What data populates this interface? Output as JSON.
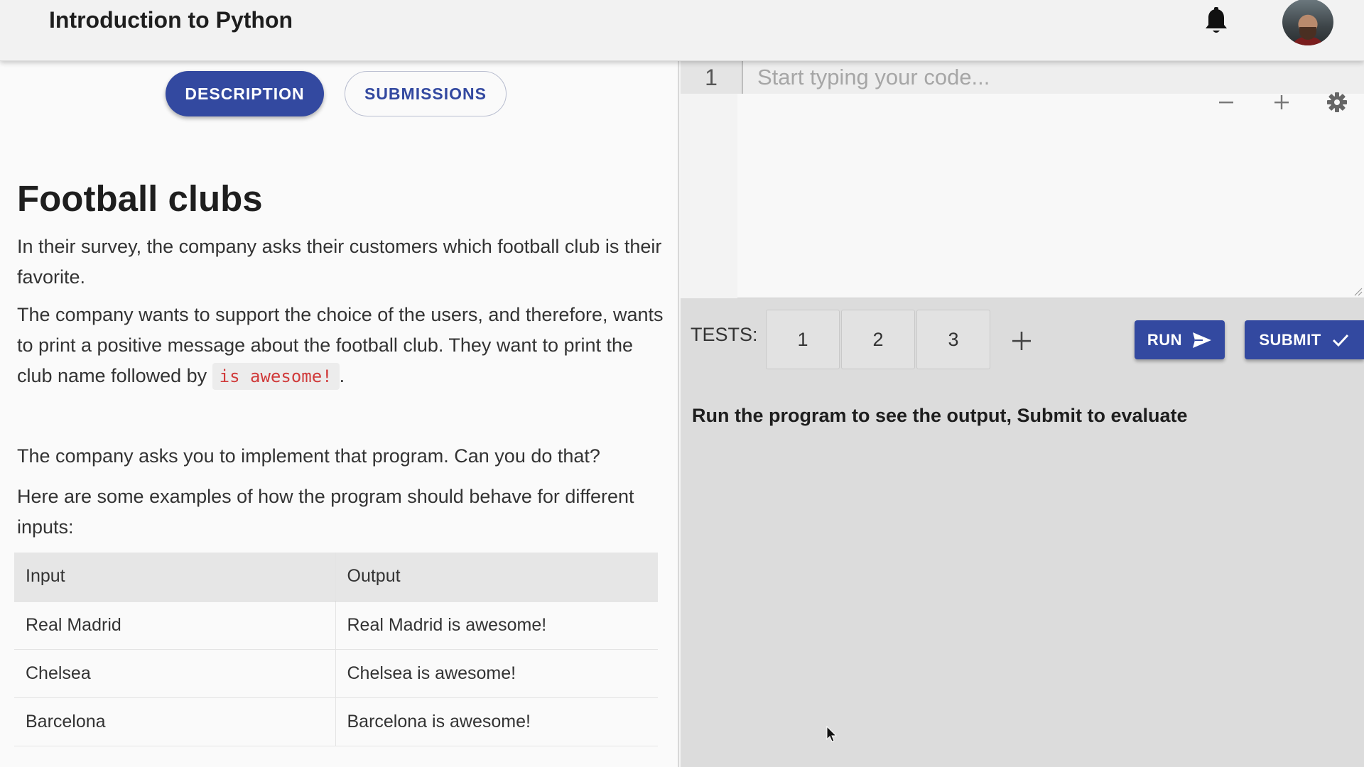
{
  "header": {
    "course_title": "Introduction to Python",
    "icons": {
      "notifications": "bell-icon",
      "profile": "avatar"
    }
  },
  "tabs": {
    "description": "DESCRIPTION",
    "submissions": "SUBMISSIONS",
    "active": "description"
  },
  "problem": {
    "title": "Football clubs",
    "para1": "In their survey, the company asks their customers which football club is their favorite.",
    "para2_a": "The company wants to support the choice of the users, and therefore, wants to print a positive message about the football club. They want to print the club name followed by",
    "para2_code": "is awesome!",
    "para2_end": ".",
    "para3": "The company asks you to implement that program. Can you do that?",
    "para4": "Here are some examples of how the program should behave for different inputs:",
    "table": {
      "headers": [
        "Input",
        "Output"
      ],
      "rows": [
        [
          "Real Madrid",
          "Real Madrid is awesome!"
        ],
        [
          "Chelsea",
          "Chelsea is awesome!"
        ],
        [
          "Barcelona",
          "Barcelona is awesome!"
        ]
      ]
    }
  },
  "editor": {
    "line_number": "1",
    "code_value": "",
    "placeholder": "Start typing your code...",
    "icons": {
      "zoom_out": "minus-icon",
      "zoom_in": "plus-icon",
      "settings": "gear-icon"
    }
  },
  "tests": {
    "label": "TESTS:",
    "items": [
      "1",
      "2",
      "3"
    ],
    "add_icon": "plus-icon",
    "run_label": "RUN",
    "submit_label": "SUBMIT",
    "output_message": "Run the program to see the output, Submit to evaluate"
  },
  "colors": {
    "primary": "#3349a0",
    "code_inline": "#d03a3a",
    "output_bg": "#dcdcdc"
  }
}
